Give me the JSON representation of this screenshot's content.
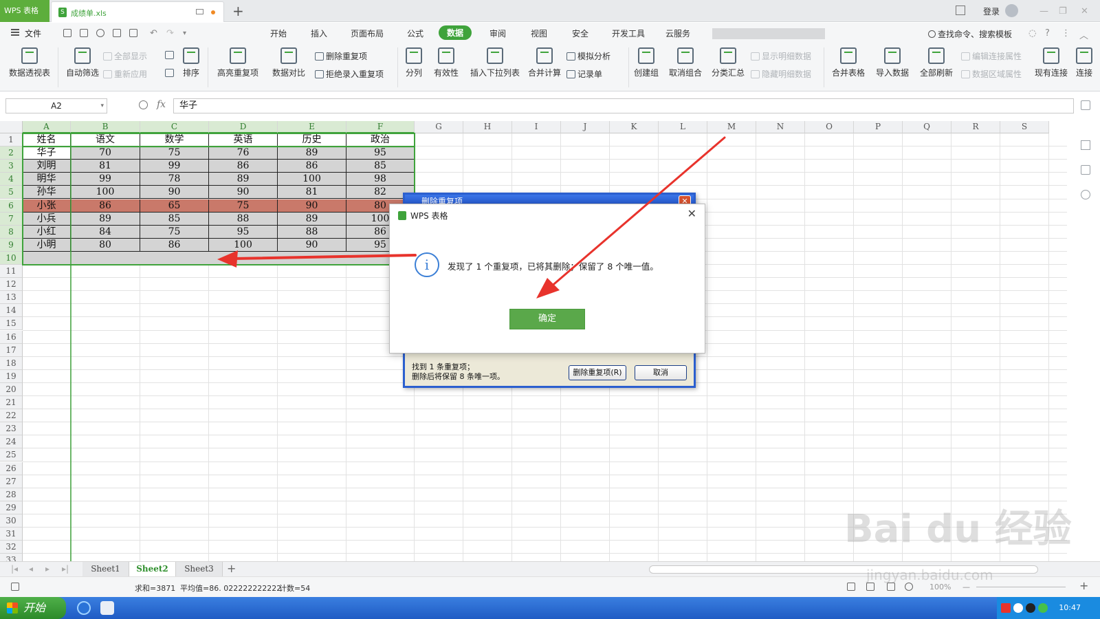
{
  "titlebar": {
    "app_tab": "WPS 表格",
    "doc_icon": "S",
    "doc_name": "成绩单.xls",
    "new_tab": "+",
    "login": "登录"
  },
  "menubar": {
    "file": "文件",
    "items": [
      "开始",
      "插入",
      "页面布局",
      "公式",
      "数据",
      "审阅",
      "视图",
      "安全",
      "开发工具",
      "云服务"
    ],
    "active": "数据",
    "search": "查找命令、搜索模板"
  },
  "ribbon": {
    "big": [
      "数据透视表",
      "自动筛选",
      "排序",
      "高亮重复项",
      "数据对比",
      "分列",
      "有效性",
      "插入下拉列表",
      "合并计算",
      "创建组",
      "取消组合",
      "分类汇总",
      "合并表格",
      "导入数据",
      "全部刷新",
      "现有连接",
      "连接"
    ],
    "small": {
      "show_all": "全部显示",
      "reapply": "重新应用",
      "remove_dup": "删除重复项",
      "reject_dup": "拒绝录入重复项",
      "simulate": "模拟分析",
      "record": "记录单",
      "show_detail": "显示明细数据",
      "hide_detail": "隐藏明细数据",
      "edit_link": "编辑连接属性",
      "range_prop": "数据区域属性"
    }
  },
  "formulabar": {
    "namebox": "A2",
    "fx": "fx",
    "value": "华子"
  },
  "sheet": {
    "columns": [
      "A",
      "B",
      "C",
      "D",
      "E",
      "F",
      "G",
      "H",
      "I",
      "J",
      "K",
      "L",
      "M",
      "N",
      "O",
      "P",
      "Q",
      "R",
      "S"
    ],
    "rows": [
      "1",
      "2",
      "3",
      "4",
      "5",
      "6",
      "7",
      "8",
      "9",
      "10",
      "11",
      "12",
      "13",
      "14",
      "15",
      "16",
      "17",
      "18",
      "19",
      "20",
      "21",
      "22",
      "23",
      "24",
      "25",
      "26",
      "27",
      "28",
      "29",
      "30",
      "31",
      "32",
      "33"
    ],
    "table": [
      [
        "姓名",
        "语文",
        "数学",
        "英语",
        "历史",
        "政治"
      ],
      [
        "华子",
        "70",
        "75",
        "76",
        "89",
        "95"
      ],
      [
        "刘明",
        "81",
        "99",
        "86",
        "86",
        "85"
      ],
      [
        "明华",
        "99",
        "78",
        "89",
        "100",
        "98"
      ],
      [
        "孙华",
        "100",
        "90",
        "90",
        "81",
        "82"
      ],
      [
        "小张",
        "86",
        "65",
        "75",
        "90",
        "80"
      ],
      [
        "小兵",
        "89",
        "85",
        "88",
        "89",
        "100"
      ],
      [
        "小红",
        "84",
        "75",
        "95",
        "88",
        "86"
      ],
      [
        "小明",
        "80",
        "86",
        "100",
        "90",
        "95"
      ]
    ],
    "highlight_color": "#c9796a",
    "selection_color": "#3fa33b"
  },
  "sheettabs": [
    "Sheet1",
    "Sheet2",
    "Sheet3"
  ],
  "active_sheet": "Sheet2",
  "add_sheet": "+",
  "status": {
    "sum": "求和=3871",
    "avg": "平均值=86. 022222222222",
    "count": "计数=54",
    "zoom": "100%"
  },
  "taskbar": {
    "start": "开始",
    "clock": "10:47"
  },
  "bg_dialog": {
    "title": "删除重复项",
    "close": "✕",
    "message": "找到 1 条重复项；\n删除后将保留 8 条唯一项。",
    "delete_btn": "删除重复项(R)",
    "cancel_btn": "取消"
  },
  "msg_dialog": {
    "title": "WPS 表格",
    "close": "✕",
    "info": "i",
    "message": "发现了 1 个重复项，已将其删除；保留了 8 个唯一值。",
    "ok": "确定"
  },
  "watermark": {
    "text": "Bai du 经验",
    "sub": "jingyan.baidu.com"
  },
  "arrow_color": "#e8332c"
}
